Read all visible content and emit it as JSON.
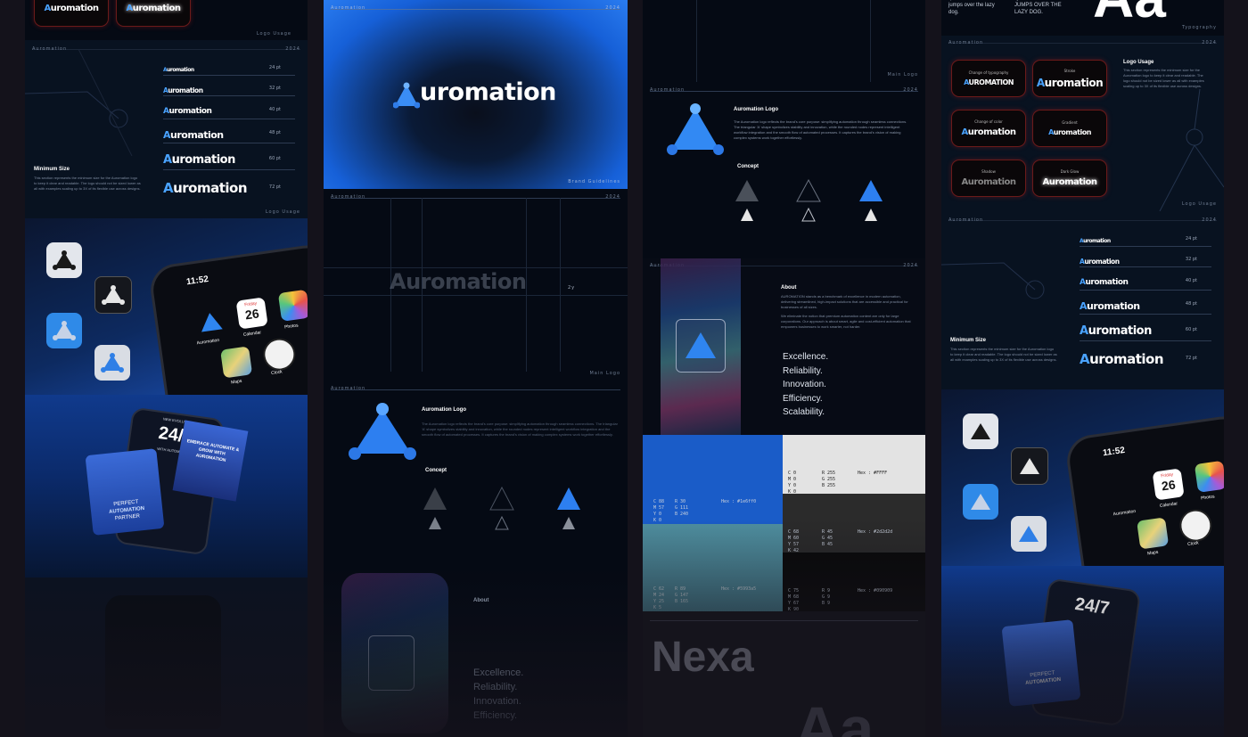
{
  "brand": {
    "name": "Auromation",
    "wordmark_suffix": "uromation",
    "wordmark_upper": "UROMATION",
    "accent": "#1e6ff0",
    "accent_light": "#4aa3ff"
  },
  "labels": {
    "top_meta_left": "Auromation",
    "top_meta_right": "2024",
    "logo_usage_footer": "Logo Usage",
    "brand_guidelines": "Brand Guidelines",
    "main_logo": "Main Logo",
    "typography": "Typography",
    "auromation_logo_title": "Auromation Logo",
    "concept_title": "Concept",
    "about_title": "About",
    "minimum_size_title": "Minimum Size",
    "logo_usage_title": "Logo Usage",
    "height_mark": "2y"
  },
  "minimum_size": {
    "body": "This section represents the minimum size for the Auromation logo to keep it clear and readable. The logo should not be sized lower as all with examples scaling up to 3X of its flexible use across designs.",
    "sizes": [
      "24 pt",
      "32 pt",
      "40 pt",
      "48 pt",
      "60 pt",
      "72 pt"
    ]
  },
  "logo_desc": "The Auromation logo reflects the brand's core purpose: simplifying automation through seamless connections. The triangular 'A' shape symbolizes stability and innovation, while the rounded nodes represent intelligent workflow integration and the smooth flow of automated processes. It captures the brand's vision of making complex systems work together effortlessly.",
  "about": {
    "p1": "AUROMATION stands as a benchmark of excellence in modern automation, delivering streamlined, high-impact solutions that are accessible and practical for businesses of all sizes.",
    "p2": "We eliminate the notion that premium automation content are only for large corporations. Our approach is about smart, agile and cost-efficient automation that empowers businesses to work smarter, not harder.",
    "values": [
      "Excellence.",
      "Reliability.",
      "Innovation.",
      "Efficiency.",
      "Scalability."
    ]
  },
  "phone": {
    "time": "11:52",
    "weekday": "Friday",
    "day": "26",
    "apps": [
      "Auromation",
      "Calendar",
      "Photos",
      "Maps",
      "Clock"
    ]
  },
  "poster": {
    "line1": "PERFECT",
    "line2": "AUTOMATION",
    "line3": "PARTNER",
    "big": "24/7",
    "small_top": "NEW EVOLUTION",
    "small_bottom": "WITH AUTOMATION",
    "card_text": "EMBRACE AUTOMATE & GROW WITH AUROMATION"
  },
  "colors": {
    "blue": {
      "cmyk": "C 88\nM 57\nY 0\nK 0",
      "rgb": "R 30\nG 111\nB 240",
      "hex": "Hex : #1e6ff0"
    },
    "white": {
      "cmyk": "C 0\nM 0\nY 0\nK 0",
      "rgb": "R 255\nG 255\nB 255",
      "hex": "Hex : #FFFF"
    },
    "teal": {
      "cmyk": "C 62\nM 24\nY 25\nK 5",
      "rgb": "R 89\nG 147\nB 165",
      "hex": "Hex : #5993a5"
    },
    "gray": {
      "cmyk": "C 68\nM 60\nY 57\nK 42",
      "rgb": "R 45\nG 45\nB 45",
      "hex": "Hex : #2d2d2d"
    },
    "black": {
      "cmyk": "C 75\nM 68\nY 67\nK 90",
      "rgb": "R 9\nG 9\nB 9",
      "hex": "Hex : #090909"
    }
  },
  "typography": {
    "pangram1": "quick brown fox jumps over the lazy dog.",
    "pangram2": "QUICK BROWN FOX JUMPS OVER THE LAZY DOG.",
    "font_name": "Nexa",
    "glyphs": "Aa"
  },
  "usage_captions": [
    "Change of typography",
    "Stroke",
    "Change of color",
    "Gradient",
    "Shadow",
    "Dark Glow"
  ]
}
